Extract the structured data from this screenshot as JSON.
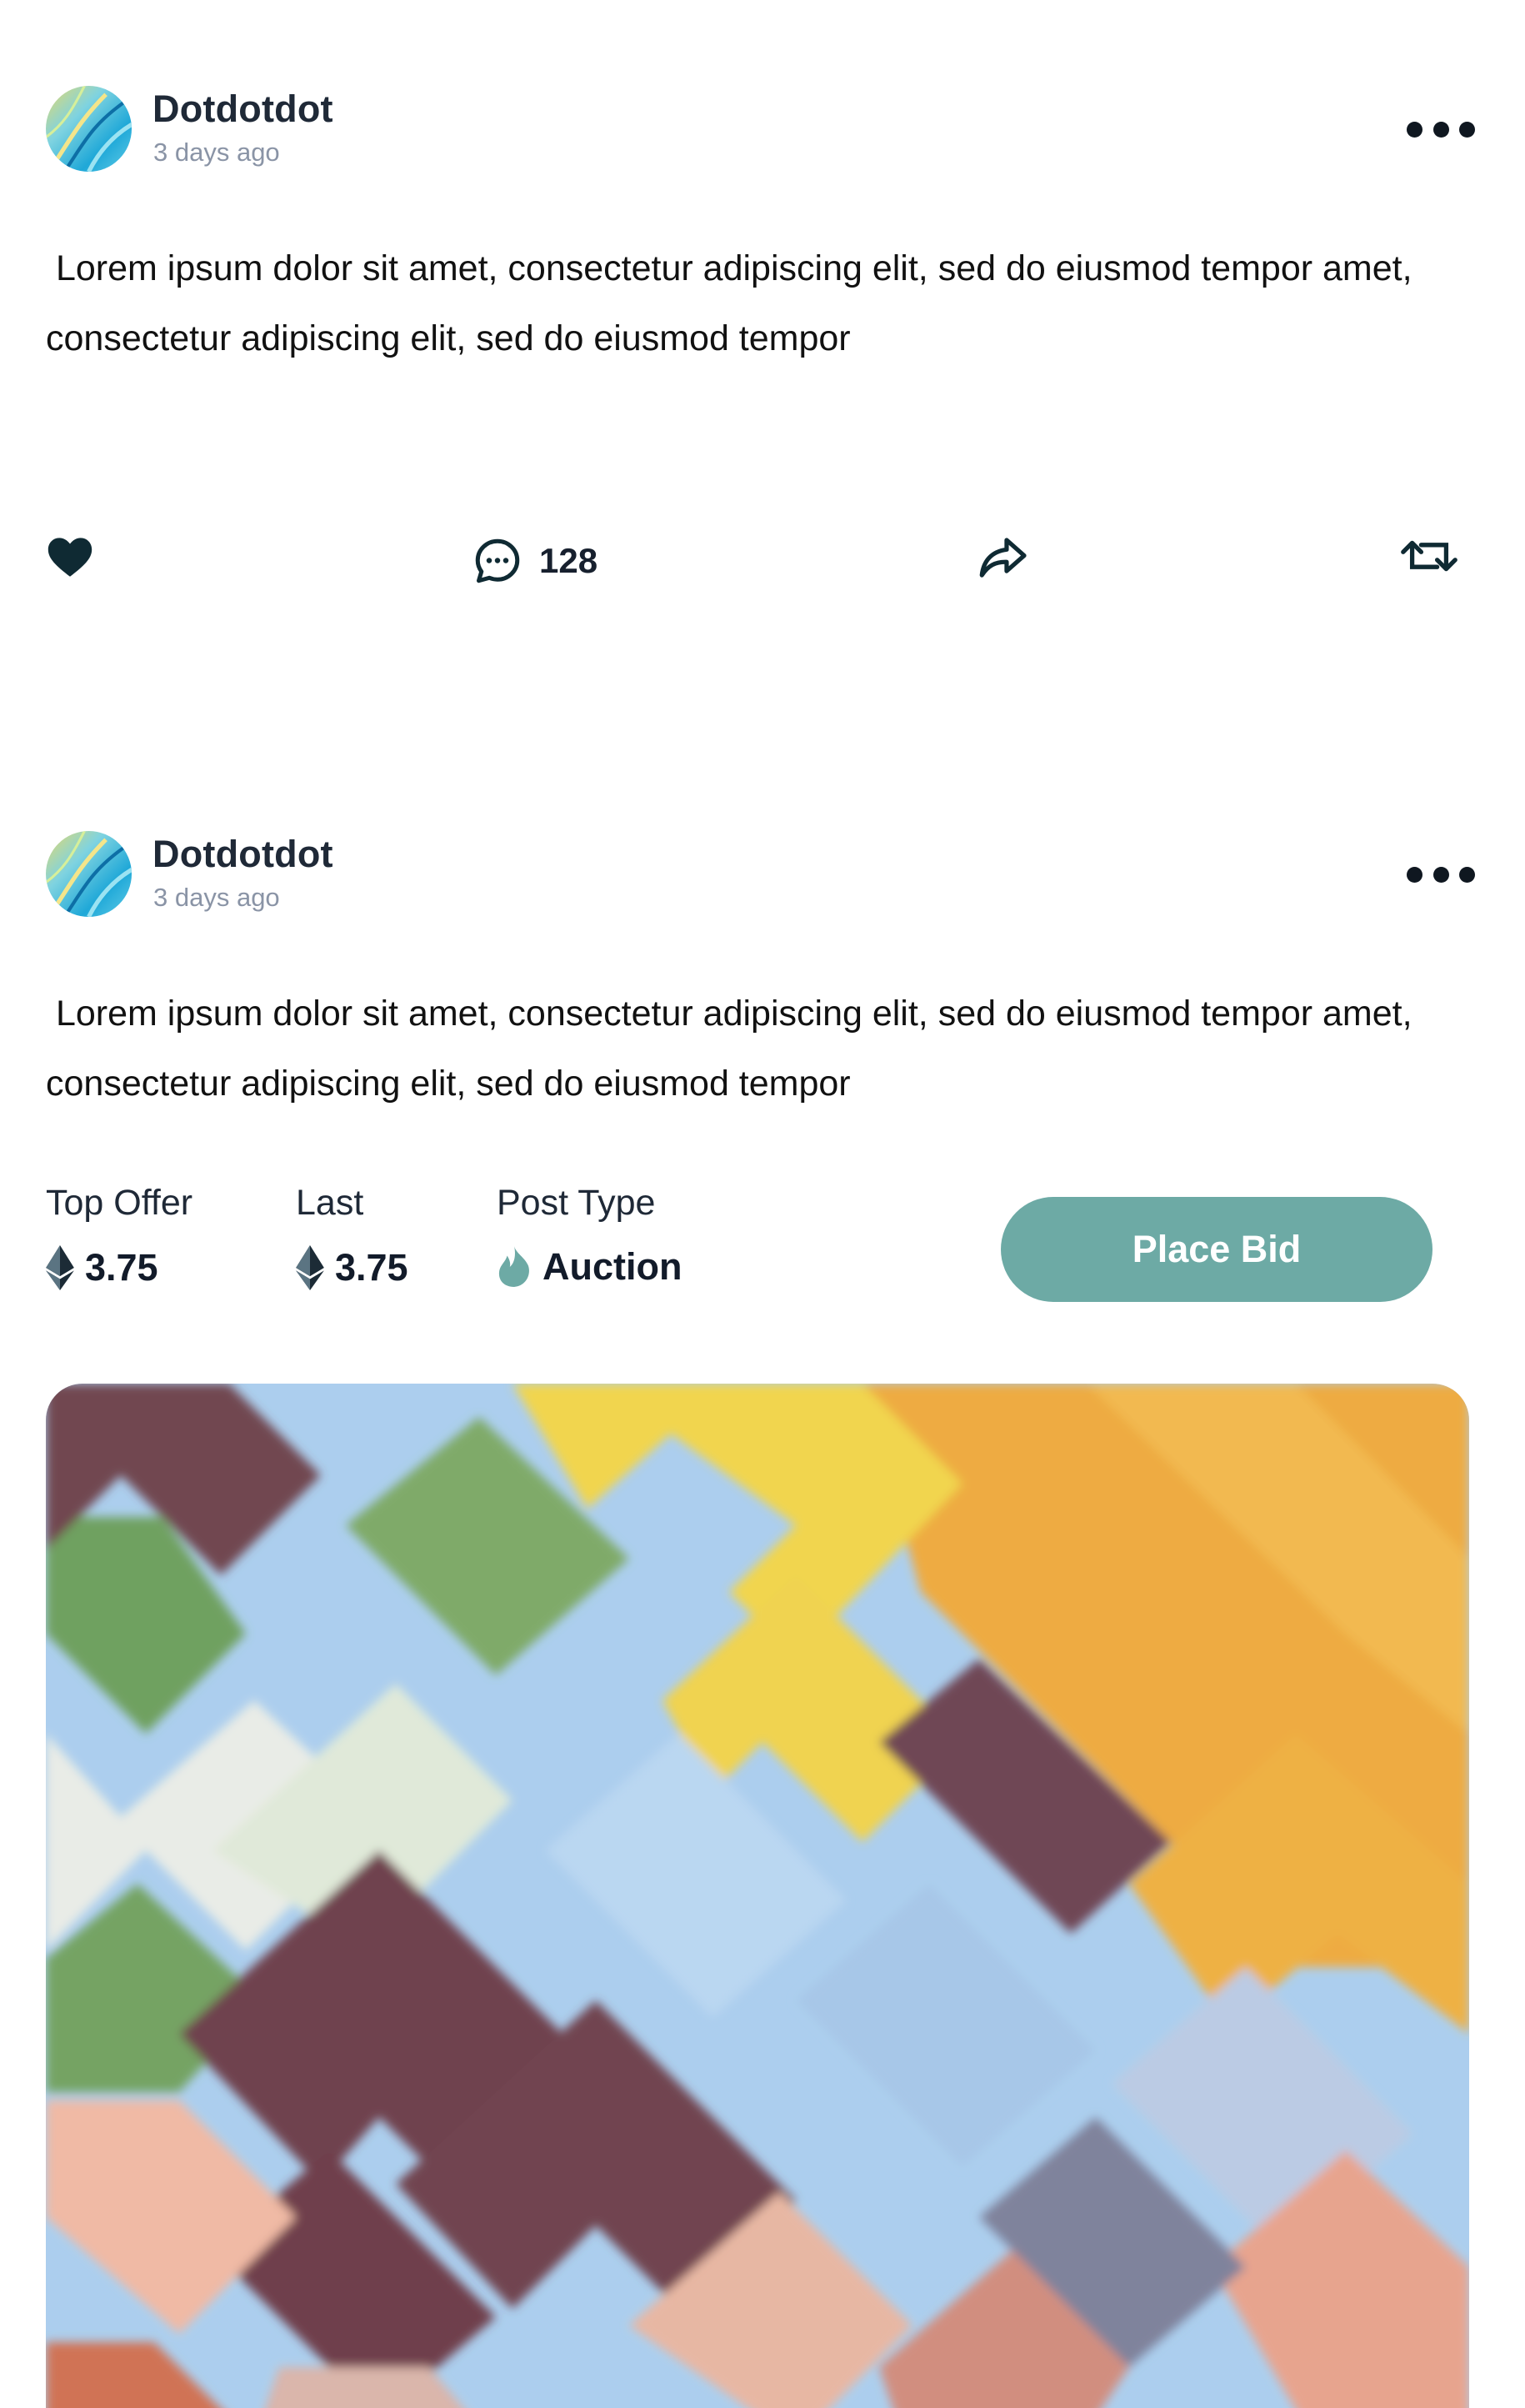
{
  "posts": [
    {
      "author": "Dotdotdot",
      "time": "3 days ago",
      "text": " Lorem ipsum dolor sit amet, consectetur adipiscing elit, sed do eiusmod tempor amet, consectetur adipiscing elit, sed do eiusmod tempor",
      "comment_count": "128",
      "icons": [
        "heart-icon",
        "comment-icon",
        "share-icon",
        "repost-icon",
        "more-icon"
      ]
    },
    {
      "author": "Dotdotdot",
      "time": "3 days ago",
      "text": " Lorem ipsum dolor sit amet, consectetur adipiscing elit, sed do eiusmod tempor amet, consectetur adipiscing elit, sed do eiusmod tempor",
      "top_offer": {
        "label": "Top Offer",
        "value": "3.75",
        "icon": "ethereum-icon"
      },
      "last": {
        "label": "Last",
        "value": "3.75",
        "icon": "ethereum-icon"
      },
      "post_type": {
        "label": "Post Type",
        "value": "Auction",
        "icon": "flame-icon"
      },
      "bid_button": "Place Bid"
    }
  ],
  "colors": {
    "accent": "#6daaa5",
    "text_dark": "#111827",
    "muted": "#8a94a6",
    "icon": "#0f2a33"
  }
}
